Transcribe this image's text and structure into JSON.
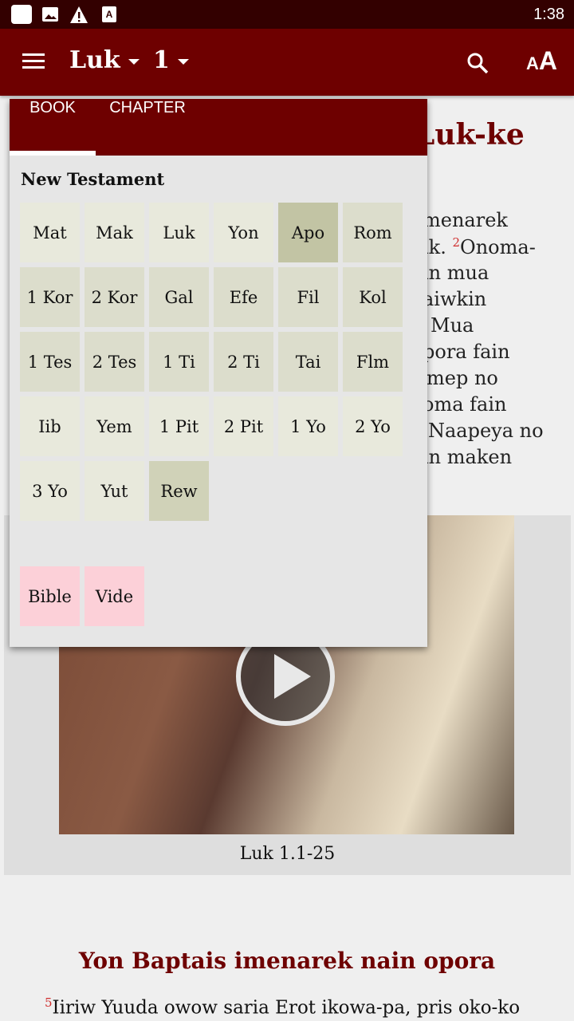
{
  "status": {
    "time": "1:38",
    "icons": [
      "app-icon",
      "image-icon",
      "warning-icon",
      "font-icon"
    ]
  },
  "appbar": {
    "book": "Luk",
    "chapter": "1",
    "icons": [
      "menu-icon",
      "search-icon",
      "text-size-icon"
    ],
    "text_size_label": "AA"
  },
  "content": {
    "title_fragment": "Luk-ke",
    "lines": [
      "menarek",
      "ik.",
      "Onoma-",
      "in mua",
      "aiwkin",
      "Mua",
      "pora fain",
      "mep no",
      "oma fain",
      "Naapeya no",
      "in maken"
    ],
    "verse2": "2",
    "video_caption": "Luk 1.1-25",
    "heading": "Yon Baptais imenarek nain opora",
    "verse5_num": "5",
    "verse5_text": "Iiriw Yuuda owow saria Erot ikowa-pa, pris oko-ko"
  },
  "popup": {
    "tabs": [
      {
        "label": "BOOK",
        "active": true
      },
      {
        "label": "CHAPTER",
        "active": false
      }
    ],
    "section": "New Testament",
    "books": [
      {
        "label": "Mat",
        "color": "#e8e9dc"
      },
      {
        "label": "Mak",
        "color": "#e8e9dc"
      },
      {
        "label": "Luk",
        "color": "#e8e9dc"
      },
      {
        "label": "Yon",
        "color": "#e8e9dc"
      },
      {
        "label": "Apo",
        "color": "#c2c4a4"
      },
      {
        "label": "Rom",
        "color": "#dcddcc"
      },
      {
        "label": "1 Kor",
        "color": "#dcddcc"
      },
      {
        "label": "2 Kor",
        "color": "#dcddcc"
      },
      {
        "label": "Gal",
        "color": "#dcddcc"
      },
      {
        "label": "Efe",
        "color": "#dcddcc"
      },
      {
        "label": "Fil",
        "color": "#dcddcc"
      },
      {
        "label": "Kol",
        "color": "#dcddcc"
      },
      {
        "label": "1 Tes",
        "color": "#dcddcc"
      },
      {
        "label": "2 Tes",
        "color": "#dcddcc"
      },
      {
        "label": "1 Ti",
        "color": "#dcddcc"
      },
      {
        "label": "2 Ti",
        "color": "#dcddcc"
      },
      {
        "label": "Tai",
        "color": "#dcddcc"
      },
      {
        "label": "Flm",
        "color": "#dcddcc"
      },
      {
        "label": "Iib",
        "color": "#e8e9dc"
      },
      {
        "label": "Yem",
        "color": "#e8e9dc"
      },
      {
        "label": "1 Pit",
        "color": "#e8e9dc"
      },
      {
        "label": "2 Pit",
        "color": "#e8e9dc"
      },
      {
        "label": "1 Yo",
        "color": "#e8e9dc"
      },
      {
        "label": "2 Yo",
        "color": "#e8e9dc"
      },
      {
        "label": "3 Yo",
        "color": "#e8e9dc"
      },
      {
        "label": "Yut",
        "color": "#e8e9dc"
      },
      {
        "label": "Rew",
        "color": "#d0d2b8"
      }
    ],
    "extras": [
      {
        "label": "Bible",
        "color": "#fcd0d8"
      },
      {
        "label": "Vide",
        "color": "#fcd0d8"
      }
    ]
  },
  "colors": {
    "primary": "#6e0000",
    "status_bar": "#330000",
    "verse_number": "#d03030"
  }
}
